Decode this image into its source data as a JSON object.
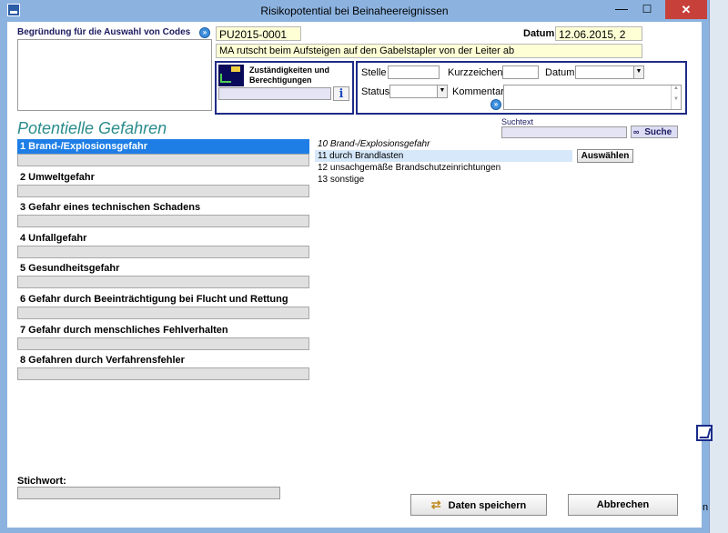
{
  "window": {
    "title": "Risikopotential bei Beinaheereignissen",
    "minimize": "—",
    "maximize": "☐",
    "close": "✕"
  },
  "begruendung": {
    "label": "Begründung für die Auswahl von Codes",
    "value": ""
  },
  "header": {
    "code": "PU2015-0001",
    "datum_label": "Datum",
    "datum_value": "12.06.2015, 2",
    "description": "MA rutscht beim Aufsteigen auf den Gabelstapler von der Leiter ab"
  },
  "zustaendigkeit": {
    "title": "Zuständigkeiten und Berechtigungen",
    "value": "",
    "info_glyph": "i"
  },
  "form": {
    "stelle_label": "Stelle",
    "stelle_value": "",
    "kurzzeichen_label": "Kurzzeichen",
    "kurzzeichen_value": "",
    "datum_label": "Datum",
    "datum_value": "",
    "status_label": "Status",
    "status_value": "",
    "kommentar_label": "Kommentar",
    "kommentar_value": ""
  },
  "section_title": "Potentielle Gefahren",
  "search": {
    "label": "Suchtext",
    "value": "",
    "button": "Suche"
  },
  "categories": [
    {
      "label": "1 Brand-/Explosionsgefahr",
      "selected": true
    },
    {
      "label": "2 Umweltgefahr",
      "selected": false
    },
    {
      "label": "3 Gefahr eines technischen Schadens",
      "selected": false
    },
    {
      "label": "4 Unfallgefahr",
      "selected": false
    },
    {
      "label": "5 Gesundheitsgefahr",
      "selected": false
    },
    {
      "label": "6 Gefahr durch Beeinträchtigung bei Flucht und Rettung",
      "selected": false
    },
    {
      "label": "7 Gefahr durch menschliches Fehlverhalten",
      "selected": false
    },
    {
      "label": "8 Gefahren durch Verfahrensfehler",
      "selected": false
    }
  ],
  "sub_items": [
    {
      "label": "10 Brand-/Explosionsgefahr",
      "style": "italic"
    },
    {
      "label": "11 durch Brandlasten",
      "style": "selected"
    },
    {
      "label": "12 unsachgemäße Brandschutzeinrichtungen",
      "style": "normal"
    },
    {
      "label": "13 sonstige",
      "style": "normal"
    }
  ],
  "auswaehlen_button": "Auswählen",
  "stichwort": {
    "label": "Stichwort:",
    "value": ""
  },
  "buttons": {
    "save": "Daten speichern",
    "cancel": "Abbrechen"
  },
  "edge": {
    "h_text": "n"
  },
  "colors": {
    "selection_blue": "#1e7ee6",
    "frame_blue": "#1f2b86",
    "title_teal": "#2b8c8c",
    "input_yellow": "#ffffd6"
  }
}
